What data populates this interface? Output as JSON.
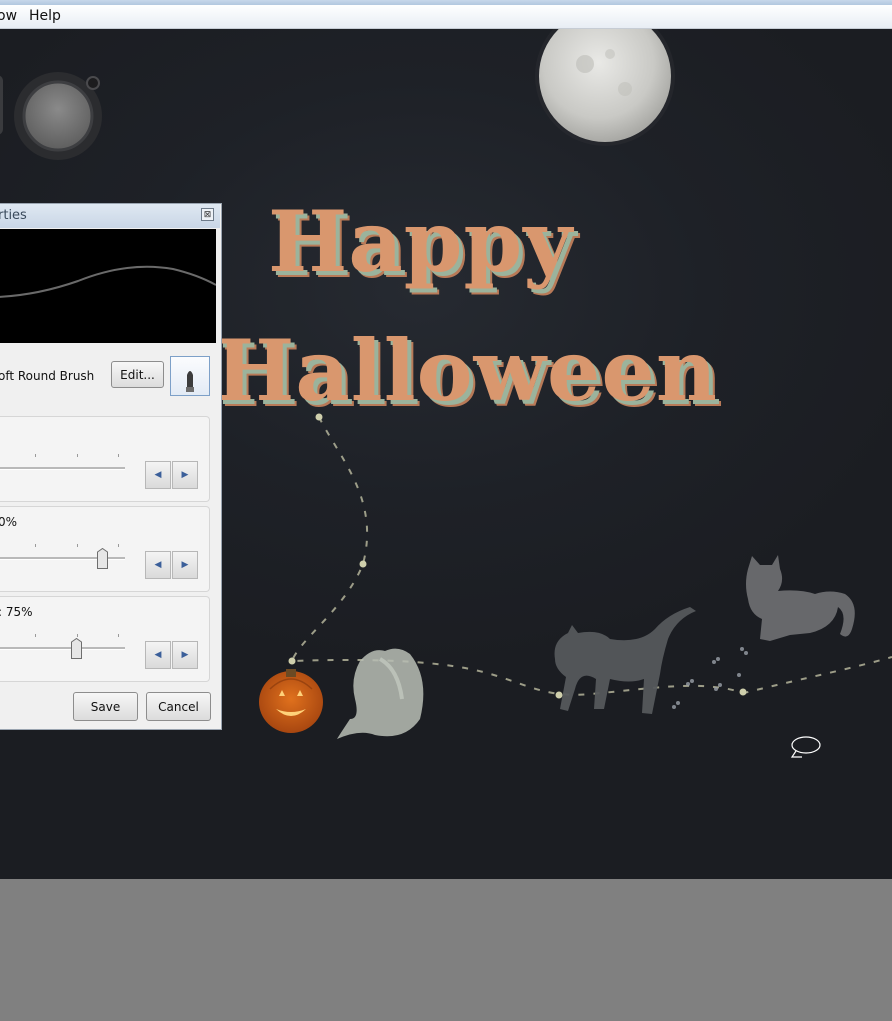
{
  "menubar": {
    "items": [
      "ow",
      "Help"
    ]
  },
  "panel": {
    "title": "rties",
    "close_glyph": "⊠",
    "brush_name": "oft Round Brush",
    "edit_label": "Edit...",
    "groups": [
      {
        "label": "",
        "value_fraction": null
      },
      {
        "label": "0%",
        "value_fraction": 0.82
      },
      {
        "label": ": 75%",
        "value_fraction": 0.62
      }
    ],
    "save_label": "Save",
    "cancel_label": "Cancel"
  },
  "artwork": {
    "line1": "Happy",
    "line2": "Halloween"
  },
  "icons": [
    "close-icon",
    "brush-icon",
    "arrow-left-icon",
    "arrow-right-icon",
    "color-dial-icon"
  ],
  "colors": {
    "text_orange": "#d9976e",
    "canvas_bg": "#1e2127",
    "panel_bg": "#f0f0f0",
    "moon": "#d8d8d4"
  }
}
